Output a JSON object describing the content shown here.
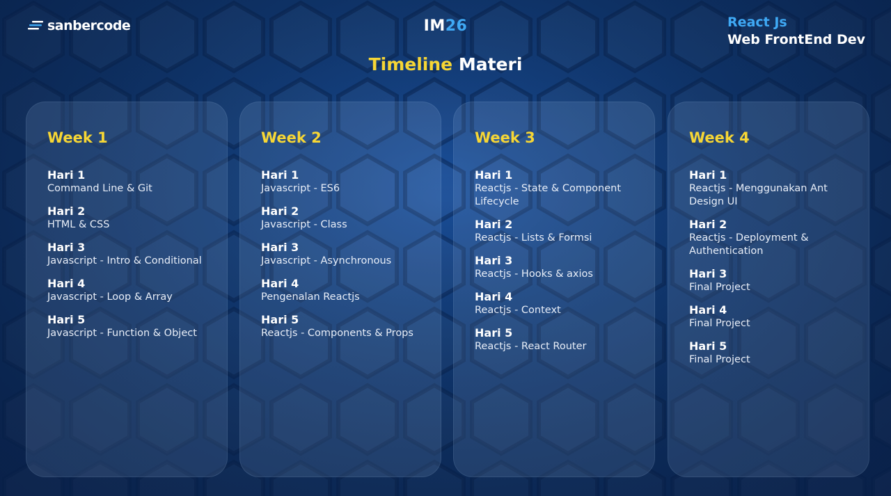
{
  "brand": {
    "logo_text": "sanbercode",
    "logo_icon": "speed-lines-icon"
  },
  "program": {
    "prefix": "IM",
    "number": "26"
  },
  "course": {
    "track": "React Js",
    "name": "Web FrontEnd Dev"
  },
  "title": {
    "highlight": "Timeline",
    "rest": "Materi"
  },
  "colors": {
    "accent_yellow": "#f6d635",
    "accent_blue": "#3fa9f5",
    "background": "#123e7d"
  },
  "weeks": [
    {
      "title": "Week 1",
      "days": [
        {
          "label": "Hari 1",
          "topic": "Command Line & Git"
        },
        {
          "label": "Hari 2",
          "topic": "HTML & CSS"
        },
        {
          "label": "Hari 3",
          "topic": "Javascript - Intro & Conditional"
        },
        {
          "label": "Hari 4",
          "topic": "Javascript - Loop & Array"
        },
        {
          "label": "Hari 5",
          "topic": "Javascript - Function & Object"
        }
      ]
    },
    {
      "title": "Week 2",
      "days": [
        {
          "label": "Hari 1",
          "topic": "Javascript - ES6"
        },
        {
          "label": "Hari 2",
          "topic": "Javascript - Class"
        },
        {
          "label": "Hari 3",
          "topic": "Javascript - Asynchronous"
        },
        {
          "label": "Hari 4",
          "topic": "Pengenalan Reactjs"
        },
        {
          "label": "Hari 5",
          "topic": "Reactjs - Components & Props"
        }
      ]
    },
    {
      "title": "Week 3",
      "days": [
        {
          "label": "Hari 1",
          "topic": "Reactjs - State & Component Lifecycle"
        },
        {
          "label": "Hari 2",
          "topic": "Reactjs - Lists & Formsi"
        },
        {
          "label": "Hari 3",
          "topic": "Reactjs - Hooks & axios"
        },
        {
          "label": "Hari 4",
          "topic": "Reactjs - Context"
        },
        {
          "label": "Hari 5",
          "topic": "Reactjs - React Router"
        }
      ]
    },
    {
      "title": "Week 4",
      "days": [
        {
          "label": "Hari 1",
          "topic": "Reactjs - Menggunakan Ant Design UI"
        },
        {
          "label": "Hari 2",
          "topic": "Reactjs - Deployment & Authentication"
        },
        {
          "label": "Hari 3",
          "topic": "Final Project"
        },
        {
          "label": "Hari 4",
          "topic": "Final Project"
        },
        {
          "label": "Hari 5",
          "topic": "Final Project"
        }
      ]
    }
  ]
}
